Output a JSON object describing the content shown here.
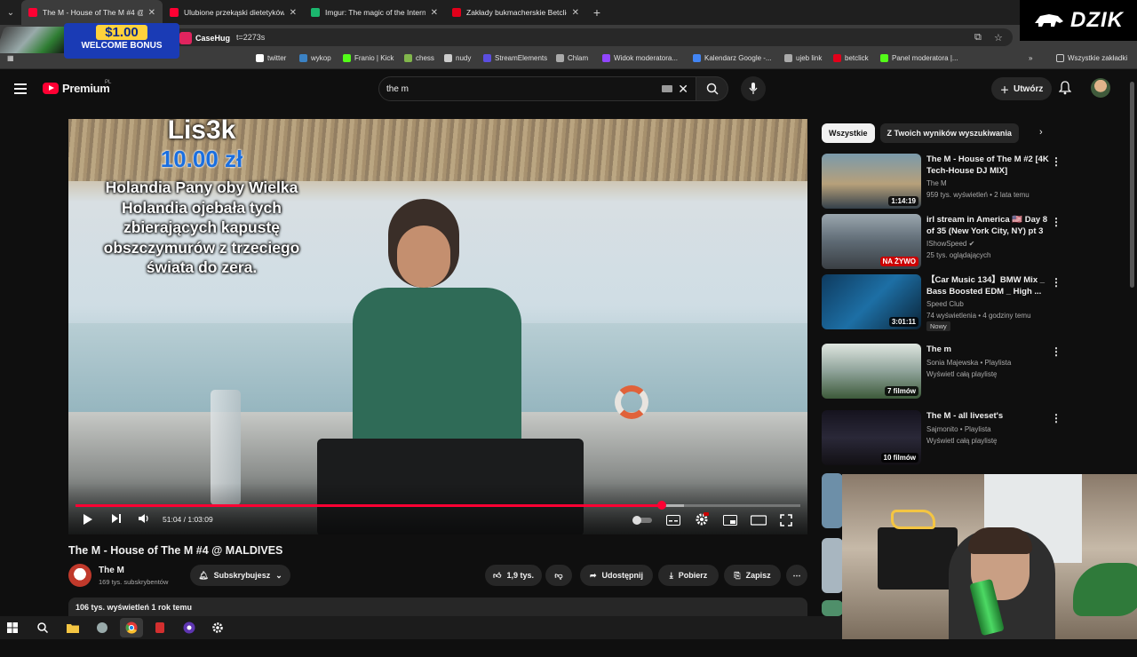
{
  "browser": {
    "tabs": [
      {
        "title": "The M - House of The M #4 @",
        "favicon_color": "#ff0033",
        "active": true
      },
      {
        "title": "Ulubione przekąski dietetyków",
        "favicon_color": "#ff0033",
        "active": false
      },
      {
        "title": "Imgur: The magic of the Internet",
        "favicon_color": "#1bb76e",
        "active": false
      },
      {
        "title": "Zakłady bukmacherskie Betclic",
        "favicon_color": "#e2001a",
        "active": false
      }
    ],
    "address_text": "t=2273s",
    "bookmarks": [
      {
        "label": "twitter",
        "color": "#ffffff"
      },
      {
        "label": "wykop",
        "color": "#3b82c4"
      },
      {
        "label": "Franio | Kick",
        "color": "#53fc18"
      },
      {
        "label": "chess",
        "color": "#81b64c"
      },
      {
        "label": "nudy",
        "color": "#cccccc"
      },
      {
        "label": "StreamElements",
        "color": "#5b4ee0"
      },
      {
        "label": "Chlam",
        "color": "#aaaaaa"
      },
      {
        "label": "Widok moderatora...",
        "color": "#9146ff"
      },
      {
        "label": "Kalendarz Google -...",
        "color": "#4285f4"
      },
      {
        "label": "ujeb link",
        "color": "#aaaaaa"
      },
      {
        "label": "betclick",
        "color": "#e2001a"
      },
      {
        "label": "Panel moderatora |...",
        "color": "#53fc18"
      }
    ],
    "all_bookmarks": "Wszystkie zakładki"
  },
  "overlay": {
    "dzik_label": "DZIK",
    "ad_amount": "$1.00",
    "ad_bonus": "WELCOME BONUS",
    "ad_brand": "CaseHug"
  },
  "youtube": {
    "logo_text": "Premium",
    "country_code": "PL",
    "search_value": "the m",
    "create_label": "Utwórz"
  },
  "donation": {
    "user": "Lis3k",
    "amount": "10.00 zł",
    "message": "Holandia Pany oby Wielka Holandia ojebała tych zbierających kapustę obszczymurów z trzeciego świata do zera."
  },
  "player": {
    "time": "51:04 / 1:03:09",
    "progress": 0.8087,
    "buffered": 0.84
  },
  "video": {
    "title": "The M - House of The M #4 @ MALDIVES",
    "channel": "The M",
    "subscribers": "169 tys. subskrybentów",
    "subscribe_label": "Subskrybujesz",
    "likes": "1,9 tys.",
    "share_label": "Udostępnij",
    "download_label": "Pobierz",
    "save_label": "Zapisz",
    "views_date": "106 tys. wyświetleń  1 rok temu"
  },
  "chips": [
    "Wszystkie",
    "Z Twoich wyników wyszukiwania"
  ],
  "recommendations": [
    {
      "title": "The M - House of The M #2 [4K Tech-House DJ MIX]",
      "channel": "The M",
      "meta": "959 tys. wyświetleń • 2 lata temu",
      "badge": "1:14:19",
      "thumb": "#6c8c9e"
    },
    {
      "title": "irl stream in America 🇺🇸 Day 8 of 35 (New York City, NY) pt 3",
      "channel": "IShowSpeed ✔",
      "meta": "25 tys. oglądających",
      "badge": "NA ŻYWO",
      "thumb": "#5e6a74"
    },
    {
      "title": "【Car Music 134】BMW Mix _ Bass Boosted EDM _ High ...",
      "channel": "Speed Club",
      "meta": "74 wyświetlenia • 4 godziny temu",
      "badge": "3:01:11",
      "new_label": "Nowy",
      "thumb": "#1d5d8a"
    },
    {
      "title": "The m",
      "channel": "Sonia Majewska • Playlista",
      "meta": "Wyświetl całą playlistę",
      "badge": "7 filmów",
      "thumb": "#8fa39a"
    },
    {
      "title": "The M - all liveset's",
      "channel": "Sajmonito • Playlista",
      "meta": "Wyświetl całą playlistę",
      "badge": "10 filmów",
      "thumb": "#2a2838"
    }
  ]
}
